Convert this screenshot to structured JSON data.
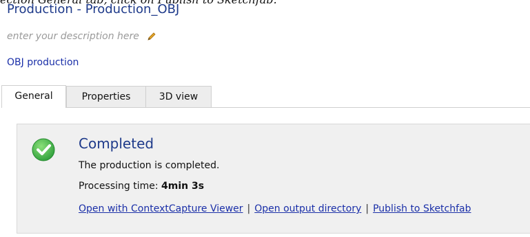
{
  "doc_text": {
    "before": "ection ",
    "emph1": "General",
    "middle": " tab, click on ",
    "emph2": "Publish to Sketchfab",
    "after": "."
  },
  "header": {
    "title": "Production - Production_OBJ",
    "description_placeholder": "enter your description here",
    "subtitle_link": "OBJ production"
  },
  "tabs": [
    {
      "label": "General",
      "active": true
    },
    {
      "label": "Properties",
      "active": false
    },
    {
      "label": "3D view",
      "active": false
    }
  ],
  "status": {
    "title": "Completed",
    "message": "The production is completed.",
    "processing_time_label": "Processing time:",
    "processing_time_value": "4min 3s",
    "links": [
      "Open with ContextCapture Viewer",
      "Open output directory",
      "Publish to Sketchfab"
    ],
    "link_separator": "|"
  },
  "colors": {
    "link": "#1a2fa8",
    "title": "#1e3a8a",
    "success": "#3cb44b",
    "panel_bg": "#f0f0f0"
  },
  "icons": {
    "edit": "pencil-icon",
    "status": "check-circle-icon"
  }
}
